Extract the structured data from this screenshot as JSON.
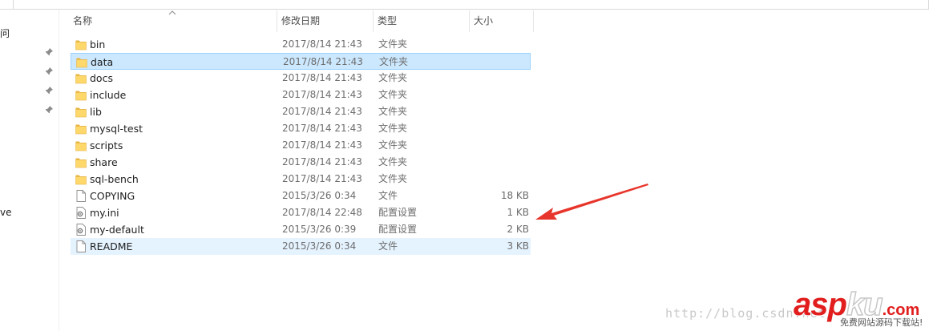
{
  "nav": {
    "fragments": [
      "问",
      "ve"
    ]
  },
  "columns": {
    "name": "名称",
    "date": "修改日期",
    "type": "类型",
    "size": "大小"
  },
  "files": [
    {
      "name": "bin",
      "date": "2017/8/14 21:43",
      "type": "文件夹",
      "size": "",
      "kind": "folder"
    },
    {
      "name": "data",
      "date": "2017/8/14 21:43",
      "type": "文件夹",
      "size": "",
      "kind": "folder"
    },
    {
      "name": "docs",
      "date": "2017/8/14 21:43",
      "type": "文件夹",
      "size": "",
      "kind": "folder"
    },
    {
      "name": "include",
      "date": "2017/8/14 21:43",
      "type": "文件夹",
      "size": "",
      "kind": "folder"
    },
    {
      "name": "lib",
      "date": "2017/8/14 21:43",
      "type": "文件夹",
      "size": "",
      "kind": "folder"
    },
    {
      "name": "mysql-test",
      "date": "2017/8/14 21:43",
      "type": "文件夹",
      "size": "",
      "kind": "folder"
    },
    {
      "name": "scripts",
      "date": "2017/8/14 21:43",
      "type": "文件夹",
      "size": "",
      "kind": "folder"
    },
    {
      "name": "share",
      "date": "2017/8/14 21:43",
      "type": "文件夹",
      "size": "",
      "kind": "folder"
    },
    {
      "name": "sql-bench",
      "date": "2017/8/14 21:43",
      "type": "文件夹",
      "size": "",
      "kind": "folder"
    },
    {
      "name": "COPYING",
      "date": "2015/3/26 0:34",
      "type": "文件",
      "size": "18 KB",
      "kind": "file"
    },
    {
      "name": "my.ini",
      "date": "2017/8/14 22:48",
      "type": "配置设置",
      "size": "1 KB",
      "kind": "config"
    },
    {
      "name": "my-default",
      "date": "2015/3/26 0:39",
      "type": "配置设置",
      "size": "2 KB",
      "kind": "config"
    },
    {
      "name": "README",
      "date": "2015/3/26 0:34",
      "type": "文件",
      "size": "3 KB",
      "kind": "file"
    }
  ],
  "icons": {
    "folder": "folder-icon",
    "file": "file-icon",
    "config": "config-file-icon",
    "pin": "pin-icon"
  },
  "colors": {
    "folder": "#ffd86b",
    "selection": "#cce8ff",
    "hover": "#e5f3ff",
    "arrow": "#e8352b",
    "logo": "#e11d1d"
  },
  "watermark": {
    "url": "http://blog.csdn.net/",
    "logo_main": "asp",
    "logo_ku": "ku",
    "logo_suffix": ".com",
    "tagline": "免费网站源码下载站!"
  }
}
